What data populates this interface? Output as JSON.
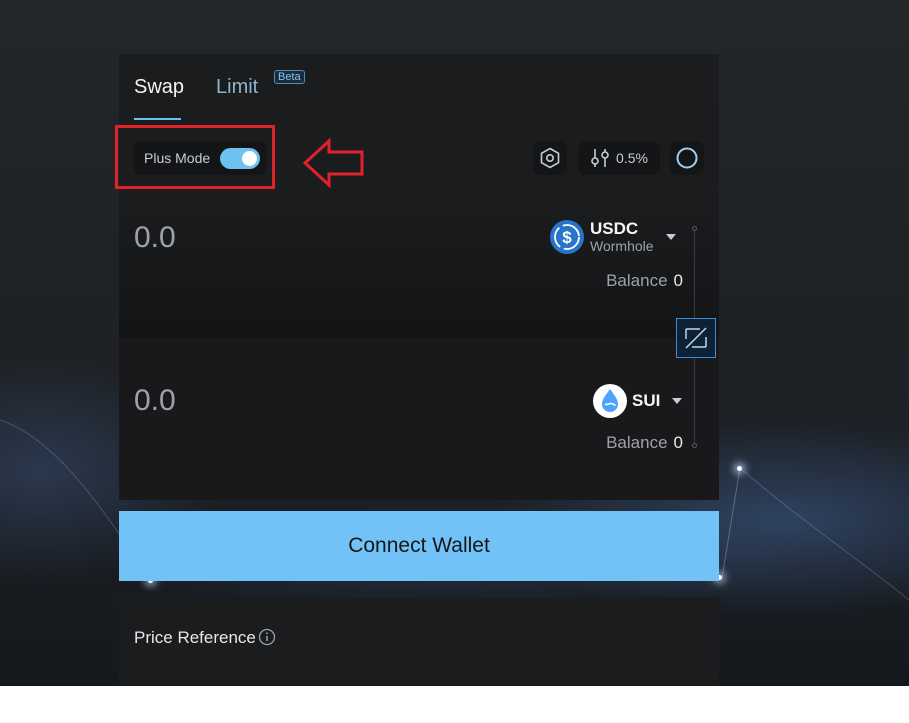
{
  "tabs": [
    {
      "label": "Swap",
      "active": true
    },
    {
      "label": "Limit",
      "active": false,
      "badge": "Beta"
    }
  ],
  "plus_mode": {
    "label": "Plus Mode",
    "enabled": true
  },
  "toolbar": {
    "settings_icon": "hexagon-settings-icon",
    "slippage": "0.5%",
    "refresh_icon": "refresh-ring-icon"
  },
  "from": {
    "amount": "0.0",
    "token": "USDC",
    "token_sub": "Wormhole",
    "balance_label": "Balance",
    "balance_value": "0"
  },
  "to": {
    "amount": "0.0",
    "token": "SUI",
    "balance_label": "Balance",
    "balance_value": "0"
  },
  "connect_label": "Connect Wallet",
  "price_reference": {
    "label": "Price Reference"
  },
  "colors": {
    "accent": "#72c2f7",
    "highlight": "#e0222b",
    "card": "#1b1c1e",
    "usdc": "#2775ca",
    "sui": "#4da2ff"
  }
}
